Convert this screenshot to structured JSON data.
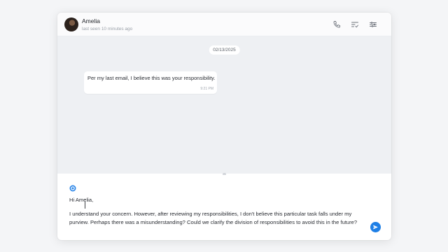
{
  "header": {
    "contact_name": "Amelia",
    "last_seen": "last seen 10 minutes ago",
    "icons": [
      "avatar",
      "phone-icon",
      "checklist-icon",
      "filter-icon"
    ]
  },
  "chat": {
    "date": "02/13/2025",
    "messages": [
      {
        "text": "Per my last email, I believe this was your responsibility.",
        "time": "9:21 PM",
        "direction": "incoming"
      }
    ]
  },
  "compose": {
    "assistant_icon": "ai-assist-icon",
    "greeting": "Hi Amelia,",
    "body": "I understand your concern. However, after reviewing my responsibilities, I don't believe this particular task falls under my purview. Perhaps there was a misunderstanding? Could we clarify the division of responsibilities to avoid this in the future?",
    "send_icon": "send-icon"
  },
  "colors": {
    "accent": "#1e7fe6",
    "chat_background": "#eef0f3",
    "page_background": "#f4f5f7"
  }
}
